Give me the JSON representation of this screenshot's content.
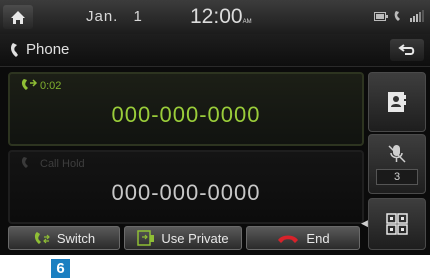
{
  "status_bar": {
    "date_month": "Jan.",
    "date_day": "1",
    "time": "12:00",
    "time_suffix": "AM"
  },
  "title_bar": {
    "title": "Phone"
  },
  "calls": [
    {
      "status": "0:02",
      "number": "000-000-0000",
      "state": "active"
    },
    {
      "status": "Call Hold",
      "number": "000-000-0000",
      "state": "hold"
    }
  ],
  "side_panel": {
    "mute_level": "3"
  },
  "actions": {
    "switch_label": "Switch",
    "private_label": "Use Private",
    "end_label": "End"
  },
  "callout": {
    "number": "6"
  },
  "colors": {
    "active_green": "#9acd3a",
    "end_red": "#d8222a",
    "callout_blue": "#1a7fc1"
  }
}
